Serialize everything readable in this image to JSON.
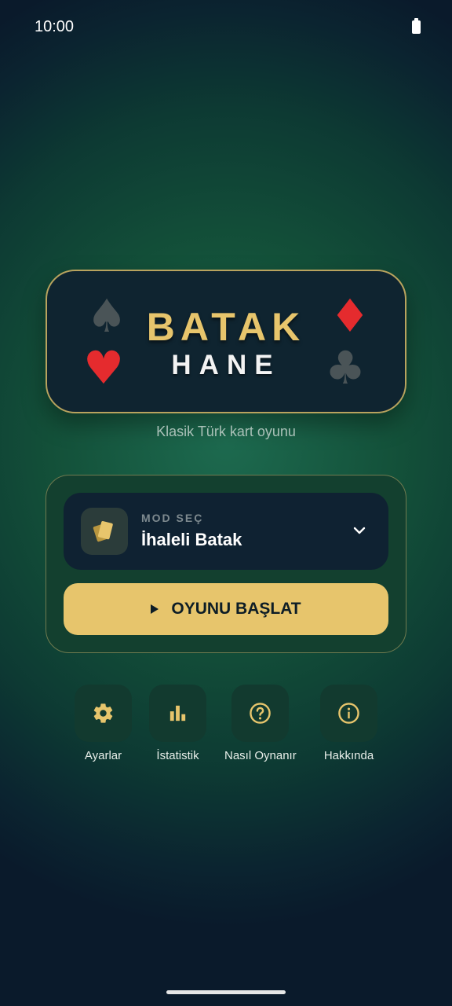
{
  "status_bar": {
    "time": "10:00"
  },
  "logo": {
    "title": "BATAK",
    "subtitle": "HANE",
    "suits": {
      "spade": "♠",
      "diamond": "♦",
      "heart": "♥",
      "club": "♣"
    }
  },
  "tagline": "Klasik Türk kart oyunu",
  "mode": {
    "label": "MOD SEÇ",
    "value": "İhaleli Batak",
    "icon": "cards-icon"
  },
  "start_button": {
    "label": "OYUNU BAŞLAT"
  },
  "menu": [
    {
      "label": "Ayarlar",
      "icon": "gear-icon"
    },
    {
      "label": "İstatistik",
      "icon": "bar-chart-icon"
    },
    {
      "label": "Nasıl Oynanır",
      "icon": "help-icon"
    },
    {
      "label": "Hakkında",
      "icon": "info-icon"
    }
  ],
  "colors": {
    "accent": "#e7c56c",
    "red_suit": "#e52b2e",
    "dark_suit": "#4a5457",
    "card_bg": "#0f2430"
  }
}
